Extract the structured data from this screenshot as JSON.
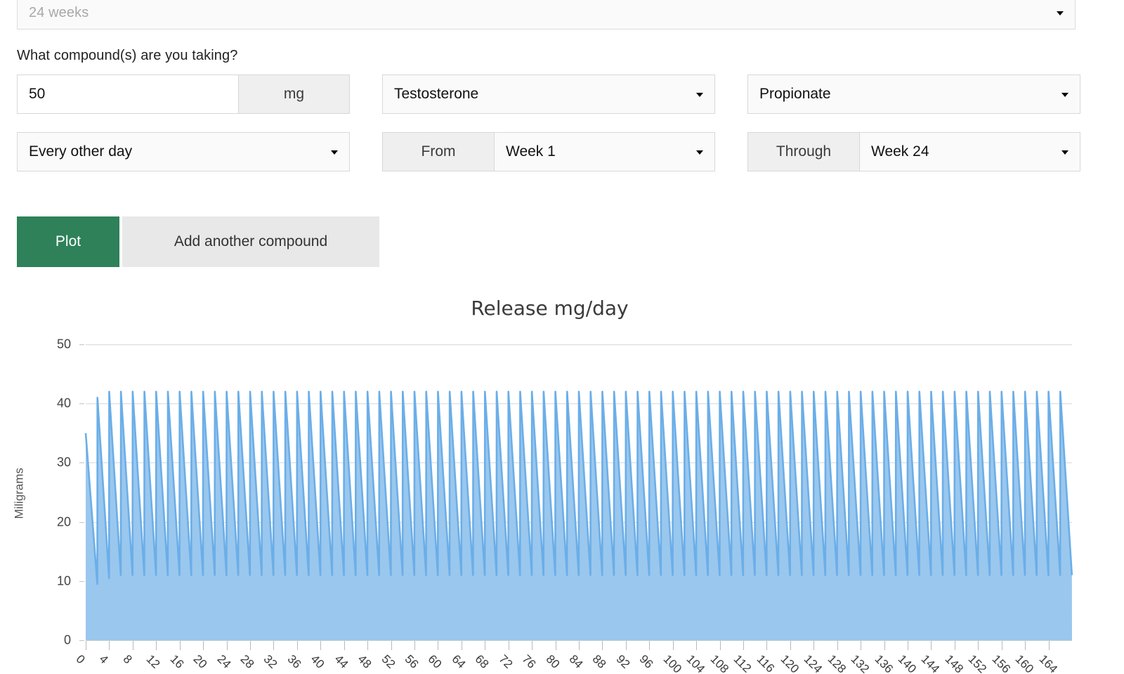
{
  "form": {
    "duration": {
      "value": "24 weeks",
      "is_placeholder": true,
      "caret_icon": "chevron-down-icon"
    },
    "question_label": "What compound(s) are you taking?",
    "dose": {
      "value": "50",
      "unit": "mg"
    },
    "compound": {
      "value": "Testosterone"
    },
    "ester": {
      "value": "Propionate"
    },
    "frequency": {
      "value": "Every other day"
    },
    "from": {
      "addon": "From",
      "value": "Week 1"
    },
    "through": {
      "addon": "Through",
      "value": "Week 24"
    }
  },
  "buttons": {
    "plot": "Plot",
    "add_compound": "Add another compound",
    "plot_color": "#2e8159",
    "add_compound_color": "#e8e8e8"
  },
  "chart_data": {
    "type": "area",
    "title": "Release mg/day",
    "xlabel": "",
    "ylabel": "Miligrams",
    "ylim": [
      0,
      50
    ],
    "xlim": [
      0,
      168
    ],
    "yticks": [
      0,
      10,
      20,
      30,
      40,
      50
    ],
    "xticks": [
      0,
      4,
      8,
      12,
      16,
      20,
      24,
      28,
      32,
      36,
      40,
      44,
      48,
      52,
      56,
      60,
      64,
      68,
      72,
      76,
      80,
      84,
      88,
      92,
      96,
      100,
      104,
      108,
      112,
      116,
      120,
      124,
      128,
      132,
      136,
      140,
      144,
      148,
      152,
      156,
      160,
      164
    ],
    "grid": true,
    "legend": false,
    "line_color": "#6baee8",
    "fill_color": "#9ac7ee",
    "series": [
      {
        "name": "Testosterone Propionate",
        "dose_mg": 50,
        "interval_days": 2,
        "description": "Sawtooth release curve: dose every other day, peaks near 42 mg/day, troughs near 11 mg/day at steady state.",
        "peak_steady_mg": 42,
        "trough_steady_mg": 11,
        "first_peak_mg": 35,
        "second_peak_mg": 41,
        "first_trough_mg": 9.5,
        "peaks_mg": [
          35,
          41,
          42,
          42,
          42,
          42,
          42,
          42,
          42,
          42,
          42,
          42,
          42,
          42,
          42,
          42,
          42,
          42,
          42,
          42,
          42,
          42,
          42,
          42,
          42,
          42,
          42,
          42,
          42,
          42,
          42,
          42,
          42,
          42,
          42,
          42,
          42,
          42,
          42,
          42,
          42,
          42,
          42,
          42,
          42,
          42,
          42,
          42,
          42,
          42,
          42,
          42,
          42,
          42,
          42,
          42,
          42,
          42,
          42,
          42,
          42,
          42,
          42,
          42,
          42,
          42,
          42,
          42,
          42,
          42,
          42,
          42,
          42,
          42,
          42,
          42,
          42,
          42,
          42,
          42,
          42,
          42,
          42,
          42
        ],
        "troughs_mg": [
          9.5,
          10.5,
          11,
          11,
          11,
          11,
          11,
          11,
          11,
          11,
          11,
          11,
          11,
          11,
          11,
          11,
          11,
          11,
          11,
          11,
          11,
          11,
          11,
          11,
          11,
          11,
          11,
          11,
          11,
          11,
          11,
          11,
          11,
          11,
          11,
          11,
          11,
          11,
          11,
          11,
          11,
          11,
          11,
          11,
          11,
          11,
          11,
          11,
          11,
          11,
          11,
          11,
          11,
          11,
          11,
          11,
          11,
          11,
          11,
          11,
          11,
          11,
          11,
          11,
          11,
          11,
          11,
          11,
          11,
          11,
          11,
          11,
          11,
          11,
          11,
          11,
          11,
          11,
          11,
          11,
          11,
          11,
          11,
          11
        ]
      }
    ]
  }
}
